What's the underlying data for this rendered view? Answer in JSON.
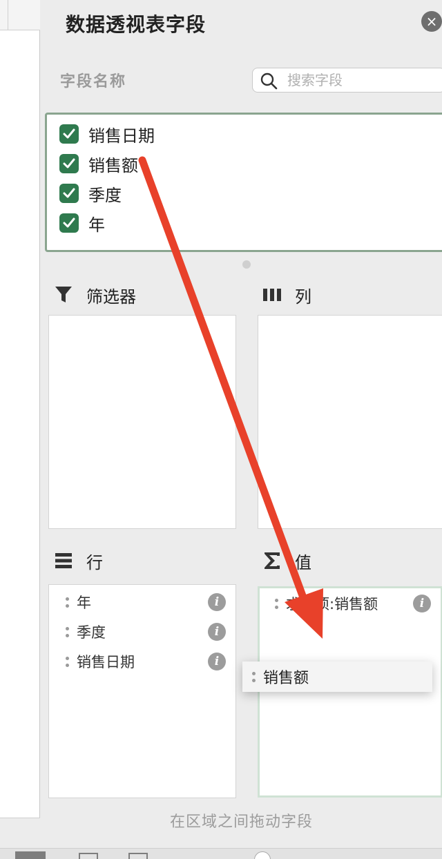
{
  "panel": {
    "title": "数据透视表字段",
    "close_symbol": "×"
  },
  "fields": {
    "section_label": "字段名称",
    "search_placeholder": "搜索字段",
    "items": [
      {
        "label": "销售日期",
        "checked": true
      },
      {
        "label": "销售额",
        "checked": true
      },
      {
        "label": "季度",
        "checked": true
      },
      {
        "label": "年",
        "checked": true
      }
    ]
  },
  "areas": {
    "filters": {
      "label": "筛选器",
      "icon": "funnel-icon",
      "items": []
    },
    "columns": {
      "label": "列",
      "icon": "columns-icon",
      "items": []
    },
    "rows": {
      "label": "行",
      "icon": "rows-icon",
      "items": [
        "年",
        "季度",
        "销售日期"
      ]
    },
    "values": {
      "label": "值",
      "icon": "sigma-icon",
      "items": [
        "求和项:销售额"
      ]
    }
  },
  "drag_chip": {
    "label": "销售额"
  },
  "hint": "在区域之间拖动字段",
  "colors": {
    "checkbox_green": "#2f7a4e",
    "list_border": "#8aa58f",
    "arrow_red": "#e8412a"
  }
}
